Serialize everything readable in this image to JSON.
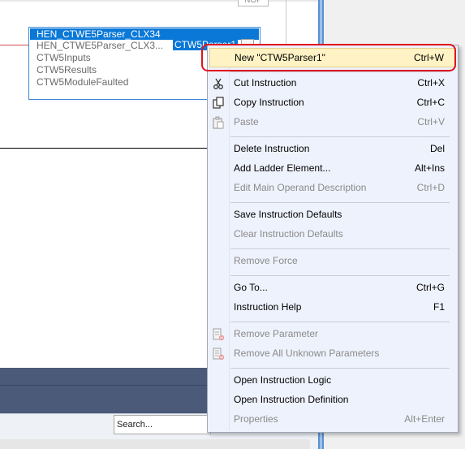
{
  "editor": {
    "nop_label": "NOP",
    "instruction": {
      "title": "HEN_CTWE5Parser_CLX34",
      "line1": "HEN_CTWE5Parser_CLX3...",
      "selected_param": "CTW5Parser1",
      "lines": [
        "CTW5Inputs",
        "CTW5Results",
        "CTW5ModuleFaulted"
      ]
    }
  },
  "bottom": {
    "search_placeholder": "Search..."
  },
  "context_menu": {
    "items": [
      {
        "label": "New \"CTW5Parser1\"",
        "shortcut": "Ctrl+W",
        "enabled": true,
        "highlighted": true
      },
      {
        "label": "Cut Instruction",
        "shortcut": "Ctrl+X",
        "enabled": true,
        "icon": "scissors-icon"
      },
      {
        "label": "Copy Instruction",
        "shortcut": "Ctrl+C",
        "enabled": true,
        "icon": "copy-icon"
      },
      {
        "label": "Paste",
        "shortcut": "Ctrl+V",
        "enabled": false,
        "icon": "paste-icon"
      },
      {
        "label": "Delete Instruction",
        "shortcut": "Del",
        "enabled": true
      },
      {
        "label": "Add Ladder Element...",
        "shortcut": "Alt+Ins",
        "enabled": true
      },
      {
        "label": "Edit Main Operand Description",
        "shortcut": "Ctrl+D",
        "enabled": false
      },
      {
        "label": "Save Instruction Defaults",
        "shortcut": "",
        "enabled": true
      },
      {
        "label": "Clear Instruction Defaults",
        "shortcut": "",
        "enabled": false
      },
      {
        "label": "Remove Force",
        "shortcut": "",
        "enabled": false
      },
      {
        "label": "Go To...",
        "shortcut": "Ctrl+G",
        "enabled": true
      },
      {
        "label": "Instruction Help",
        "shortcut": "F1",
        "enabled": true
      },
      {
        "label": "Remove Parameter",
        "shortcut": "",
        "enabled": false,
        "icon": "remove-parameter-icon"
      },
      {
        "label": "Remove All Unknown Parameters",
        "shortcut": "",
        "enabled": false,
        "icon": "remove-all-parameters-icon"
      },
      {
        "label": "Open Instruction Logic",
        "shortcut": "",
        "enabled": true
      },
      {
        "label": "Open Instruction Definition",
        "shortcut": "",
        "enabled": true
      },
      {
        "label": "Properties",
        "shortcut": "Alt+Enter",
        "enabled": false
      }
    ],
    "highlight_color": "#e0121e"
  }
}
